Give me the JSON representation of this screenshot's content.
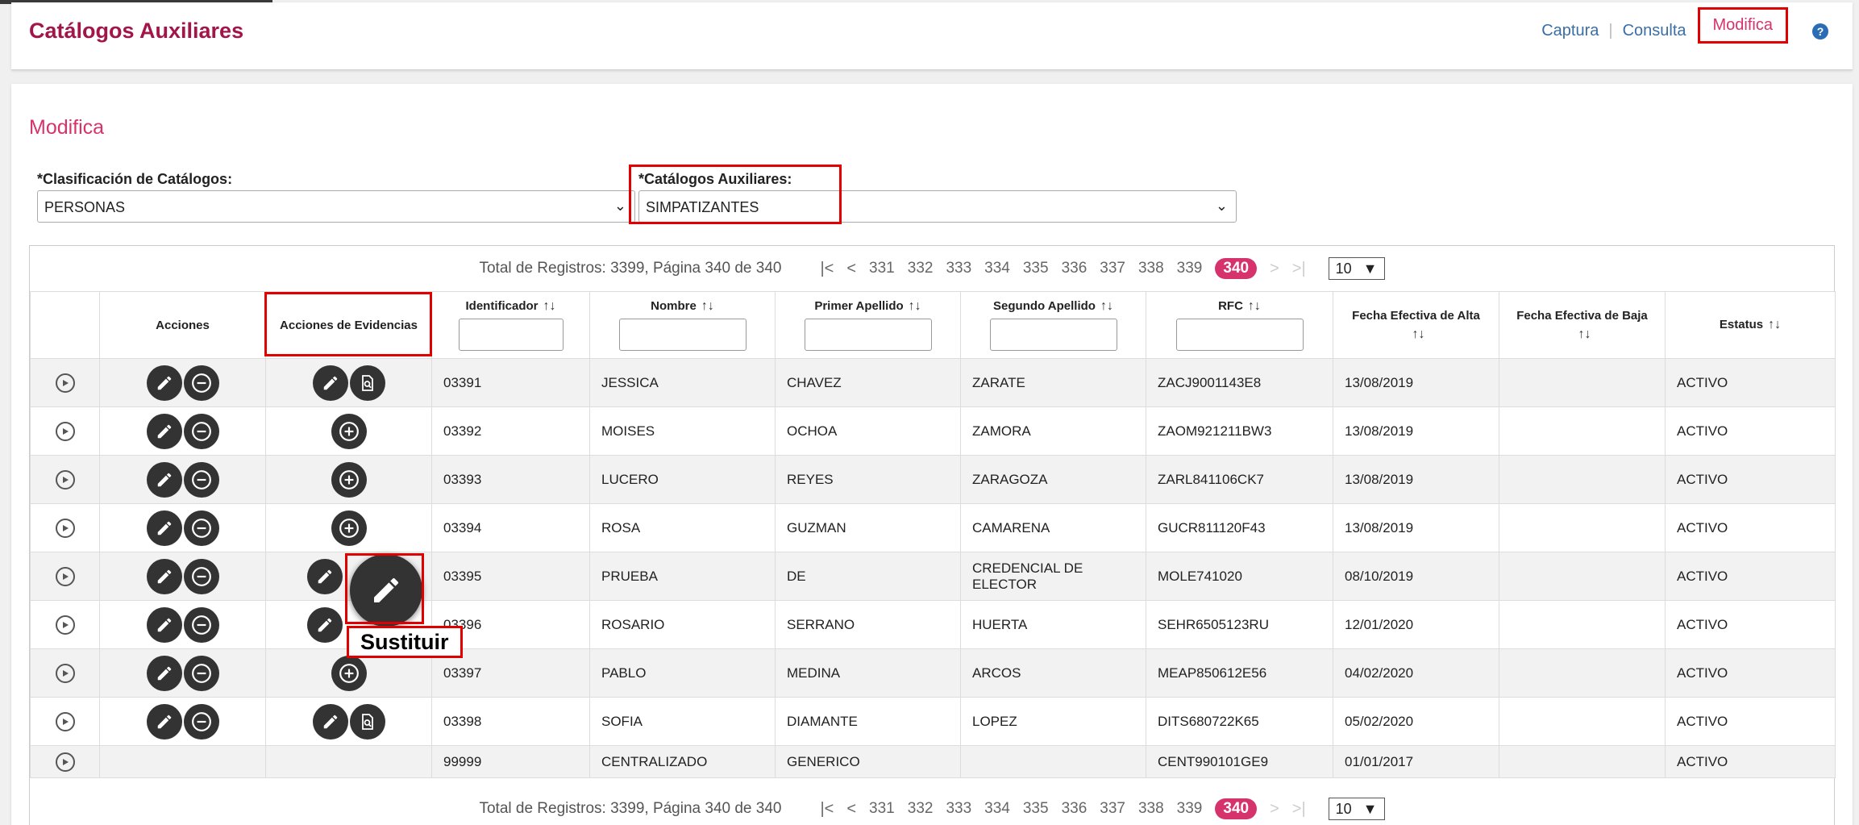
{
  "header": {
    "title": "Catálogos Auxiliares",
    "nav": [
      {
        "label": "Captura"
      },
      {
        "label": "Consulta"
      },
      {
        "label": "Modifica"
      }
    ],
    "help_icon": "question-circle-icon"
  },
  "section": {
    "title": "Modifica",
    "clasificacion_label": "*Clasificación de Catálogos:",
    "clasificacion_value": "PERSONAS",
    "catalogo_label": "*Catálogos Auxiliares:",
    "catalogo_value": "SIMPATIZANTES"
  },
  "pager": {
    "total_text": "Total de Registros: 3399, Página 340 de 340",
    "first": "|<",
    "prev": "<",
    "next": ">",
    "last": ">|",
    "pages": [
      "331",
      "332",
      "333",
      "334",
      "335",
      "336",
      "337",
      "338",
      "339"
    ],
    "current": "340",
    "page_size": "10"
  },
  "table": {
    "headers": {
      "acciones": "Acciones",
      "evidencias": "Acciones de Evidencias",
      "identificador": "Identificador",
      "nombre": "Nombre",
      "primer_apellido": "Primer Apellido",
      "segundo_apellido": "Segundo Apellido",
      "rfc": "RFC",
      "fecha_alta": "Fecha Efectiva de Alta",
      "fecha_baja": "Fecha Efectiva de Baja",
      "estatus": "Estatus"
    },
    "sort_glyph": "↑↓",
    "rows": [
      {
        "id": "03391",
        "nombre": "JESSICA",
        "ap1": "CHAVEZ",
        "ap2": "ZARATE",
        "rfc": "ZACJ9001143E8",
        "alta": "13/08/2019",
        "baja": "",
        "estatus": "ACTIVO",
        "evid": "edit-view"
      },
      {
        "id": "03392",
        "nombre": "MOISES",
        "ap1": "OCHOA",
        "ap2": "ZAMORA",
        "rfc": "ZAOM921211BW3",
        "alta": "13/08/2019",
        "baja": "",
        "estatus": "ACTIVO",
        "evid": "add"
      },
      {
        "id": "03393",
        "nombre": "LUCERO",
        "ap1": "REYES",
        "ap2": "ZARAGOZA",
        "rfc": "ZARL841106CK7",
        "alta": "13/08/2019",
        "baja": "",
        "estatus": "ACTIVO",
        "evid": "add"
      },
      {
        "id": "03394",
        "nombre": "ROSA",
        "ap1": "GUZMAN",
        "ap2": "CAMARENA",
        "rfc": "GUCR811120F43",
        "alta": "13/08/2019",
        "baja": "",
        "estatus": "ACTIVO",
        "evid": "add"
      },
      {
        "id": "03395",
        "nombre": "PRUEBA",
        "ap1": "DE",
        "ap2": "CREDENCIAL DE ELECTOR",
        "rfc": "MOLE741020",
        "alta": "08/10/2019",
        "baja": "",
        "estatus": "ACTIVO",
        "evid": "edit"
      },
      {
        "id": "03396",
        "nombre": "ROSARIO",
        "ap1": "SERRANO",
        "ap2": "HUERTA",
        "rfc": "SEHR6505123RU",
        "alta": "12/01/2020",
        "baja": "",
        "estatus": "ACTIVO",
        "evid": "edit"
      },
      {
        "id": "03397",
        "nombre": "PABLO",
        "ap1": "MEDINA",
        "ap2": "ARCOS",
        "rfc": "MEAP850612E56",
        "alta": "04/02/2020",
        "baja": "",
        "estatus": "ACTIVO",
        "evid": "add"
      },
      {
        "id": "03398",
        "nombre": "SOFIA",
        "ap1": "DIAMANTE",
        "ap2": "LOPEZ",
        "rfc": "DITS680722K65",
        "alta": "05/02/2020",
        "baja": "",
        "estatus": "ACTIVO",
        "evid": "edit-view"
      },
      {
        "id": "99999",
        "nombre": "CENTRALIZADO",
        "ap1": "GENERICO",
        "ap2": "",
        "rfc": "CENT990101GE9",
        "alta": "01/01/2017",
        "baja": "",
        "estatus": "ACTIVO",
        "evid": "none"
      }
    ]
  },
  "tooltip": {
    "label": "Sustituir"
  },
  "colors": {
    "brand": "#a3154a",
    "accent": "#d6336c",
    "link": "#3a6ea5",
    "highlight": "#e00000"
  }
}
